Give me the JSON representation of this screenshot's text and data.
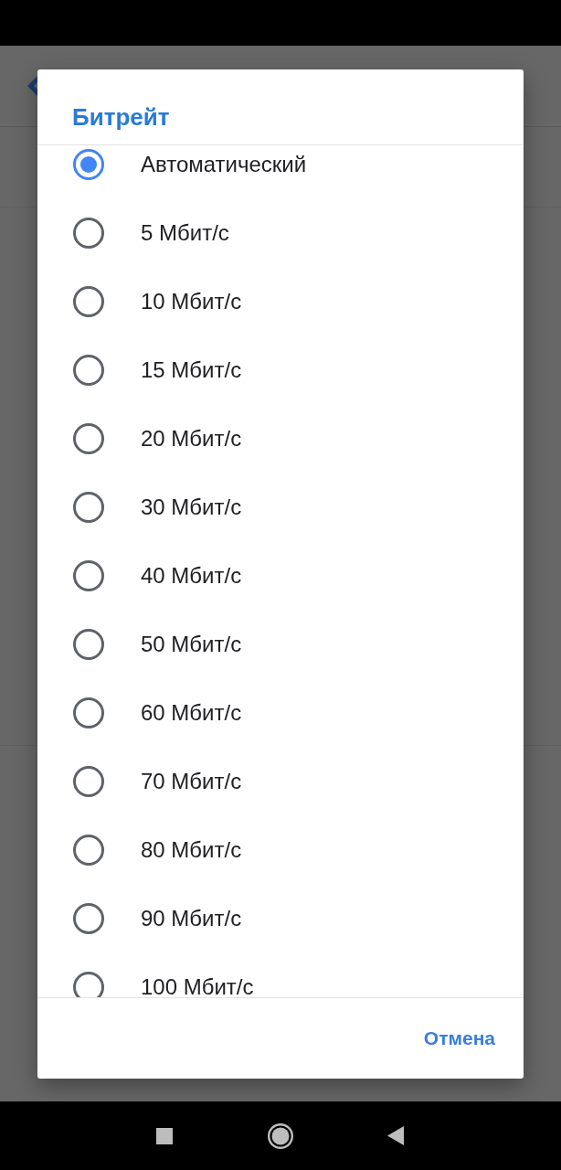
{
  "dialog": {
    "title": "Битрейт",
    "options": [
      {
        "label": "Автоматический",
        "selected": true
      },
      {
        "label": "5 Мбит/с",
        "selected": false
      },
      {
        "label": "10 Мбит/с",
        "selected": false
      },
      {
        "label": "15 Мбит/с",
        "selected": false
      },
      {
        "label": "20 Мбит/с",
        "selected": false
      },
      {
        "label": "30 Мбит/с",
        "selected": false
      },
      {
        "label": "40 Мбит/с",
        "selected": false
      },
      {
        "label": "50 Мбит/с",
        "selected": false
      },
      {
        "label": "60 Мбит/с",
        "selected": false
      },
      {
        "label": "70 Мбит/с",
        "selected": false
      },
      {
        "label": "80 Мбит/с",
        "selected": false
      },
      {
        "label": "90 Мбит/с",
        "selected": false
      },
      {
        "label": "100 Мбит/с",
        "selected": false
      }
    ],
    "buttons": [
      {
        "label": "Отмена"
      }
    ]
  }
}
